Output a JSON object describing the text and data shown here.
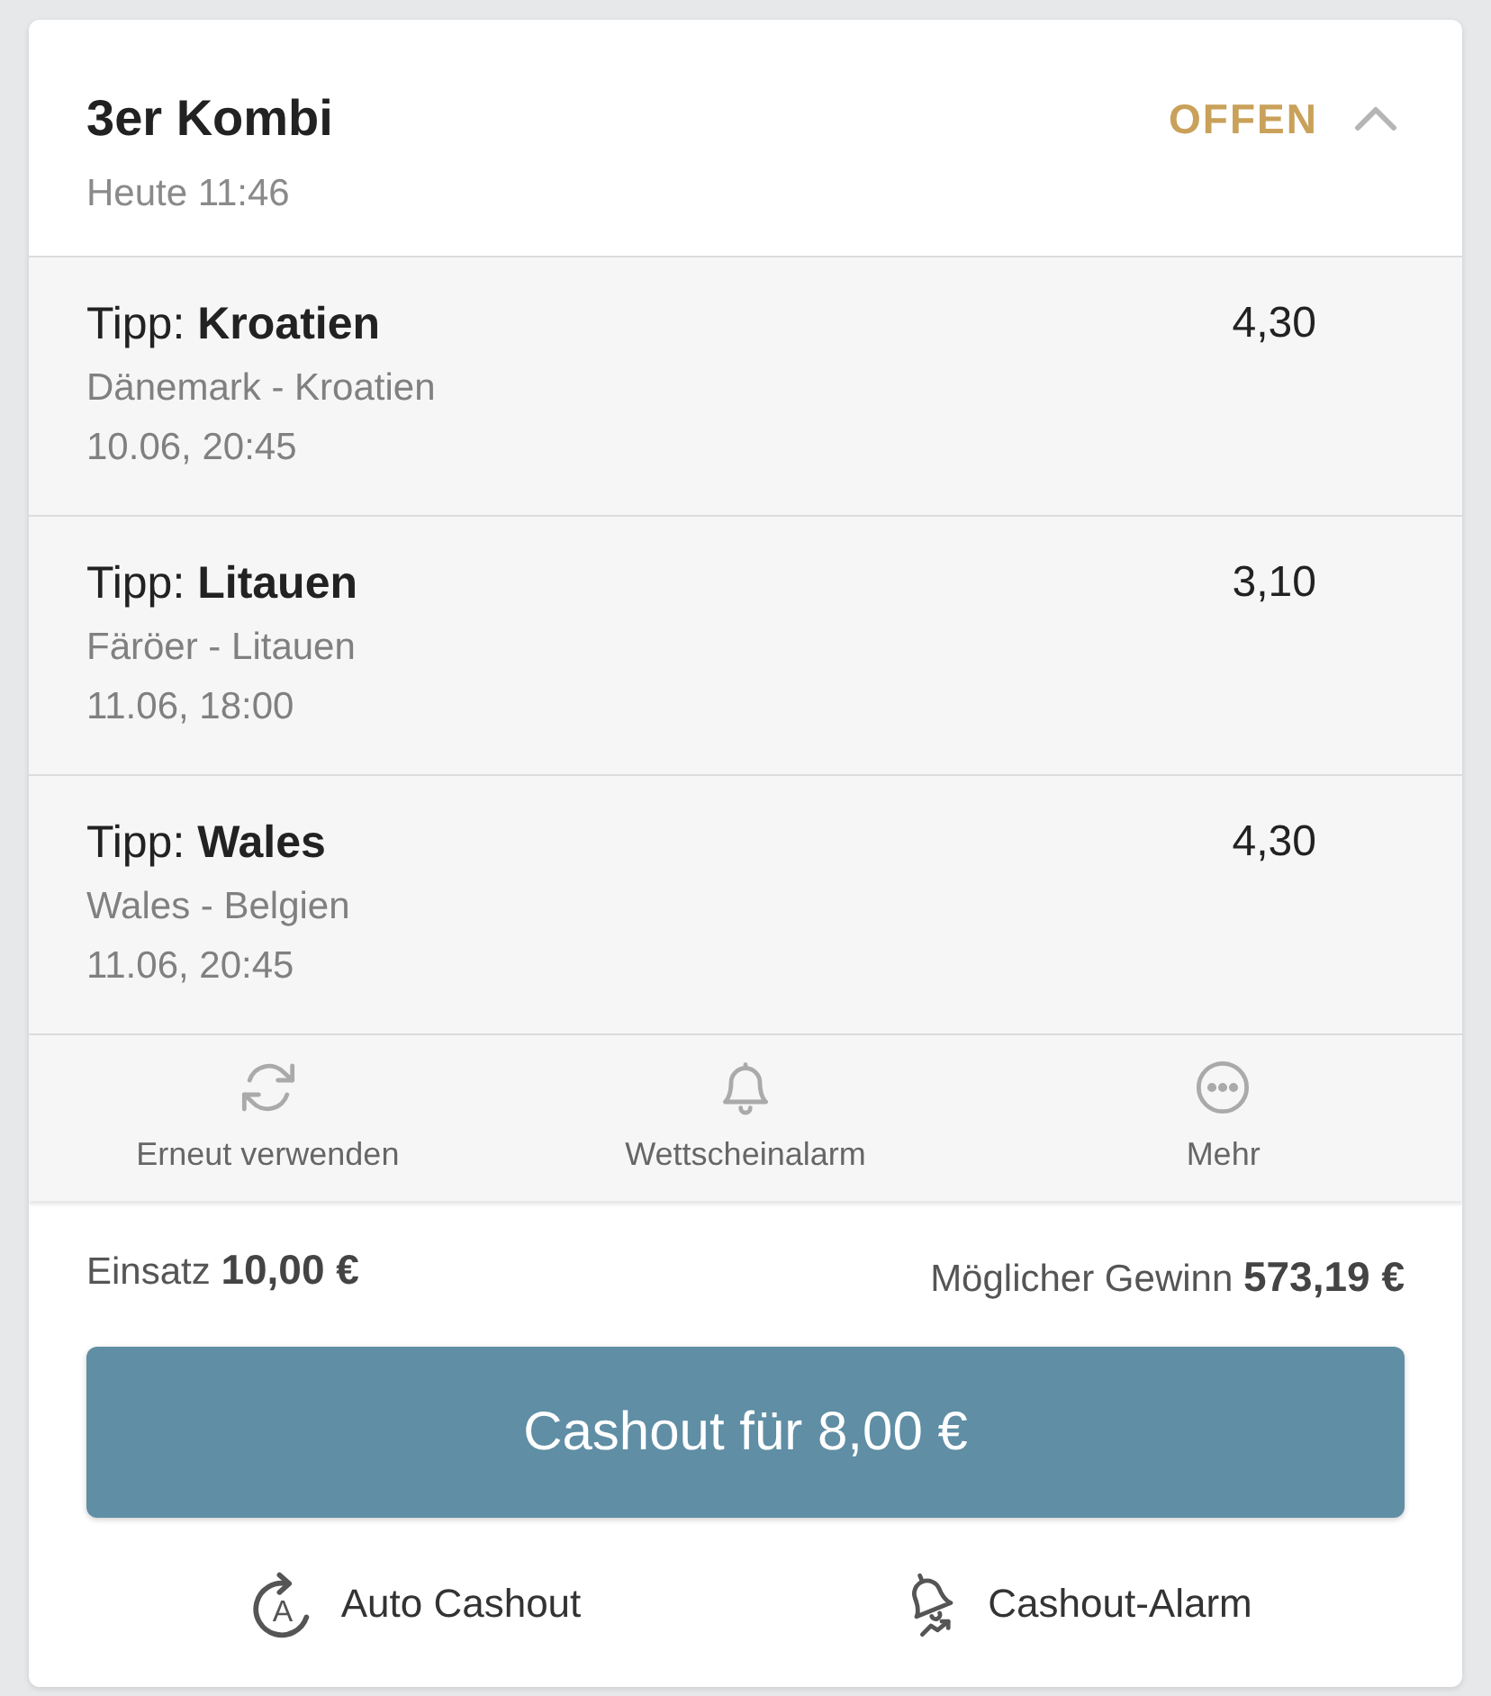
{
  "bet": {
    "title": "3er Kombi",
    "time": "Heute 11:46",
    "status": "OFFEN",
    "expanded": true
  },
  "selections": [
    {
      "tip": "Tipp: **Kroatien**",
      "match": "Dänemark - Kroatien",
      "date": "10.06, 20:45",
      "odds": "4,30"
    },
    {
      "tip": "Tipp: **Litauen**",
      "match": "Färöer - Litauen",
      "date": "11.06, 18:00",
      "odds": "3,10"
    },
    {
      "tip": "Tipp: **Wales**",
      "match": "Wales - Belgien",
      "date": "11.06, 20:45",
      "odds": "4,30"
    }
  ],
  "actions": [
    {
      "kind": "reuse",
      "label": "Erneut verwenden"
    },
    {
      "kind": "alarm",
      "label": "Wettscheinalarm"
    },
    {
      "kind": "more",
      "label": "Mehr"
    }
  ],
  "summary": {
    "stake": "Einsatz **10,00 €**",
    "potential_win": "Möglicher Gewinn **573,19 €**"
  },
  "cashout_button": "Cashout für 8,00 €",
  "options": [
    {
      "kind": "auto",
      "label": "Auto Cashout",
      "icon_letter": "A"
    },
    {
      "kind": "alarm",
      "label": "Cashout-Alarm"
    }
  ]
}
